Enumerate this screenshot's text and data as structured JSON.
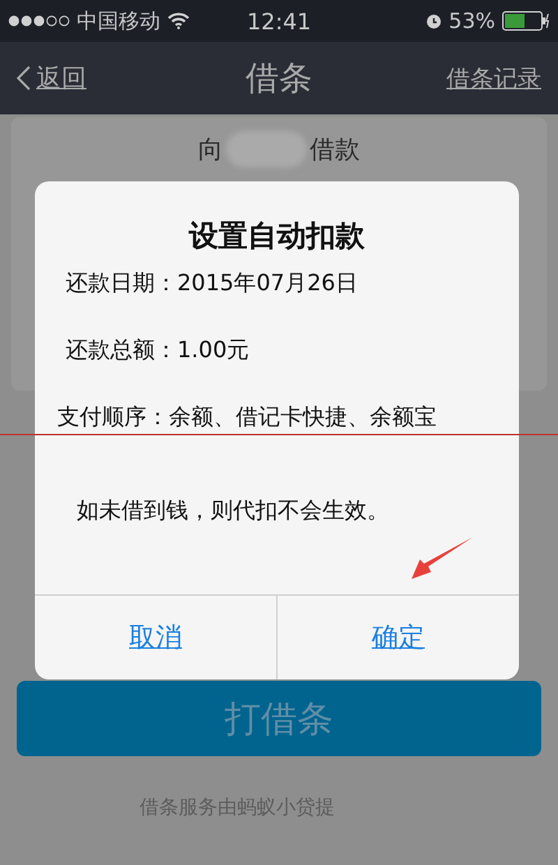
{
  "status_bar": {
    "carrier": "中国移动",
    "time": "12:41",
    "battery": "53%"
  },
  "nav": {
    "back": "返回",
    "title": "借条",
    "right_link": "借条记录"
  },
  "loan": {
    "prefix": "向",
    "suffix": "借款"
  },
  "dialog": {
    "title": "设置自动扣款",
    "rows": [
      {
        "label": "还款日期：",
        "value": "2015年07月26日"
      },
      {
        "label": "还款总额：",
        "value": "1.00元"
      },
      {
        "label": "支付顺序：",
        "value": "余额、借记卡快捷、余额宝"
      }
    ],
    "note": "如未借到钱，则代扣不会生效。",
    "buttons": [
      {
        "label": "取消"
      },
      {
        "label": "确定"
      }
    ]
  },
  "primary_button": "打借条",
  "footer": "借条服务由蚂蚁小贷提"
}
